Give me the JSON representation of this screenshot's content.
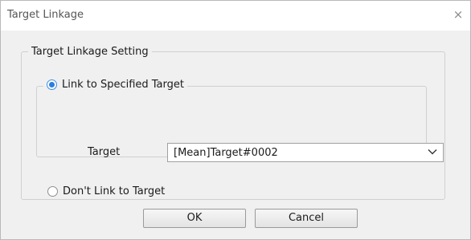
{
  "window": {
    "title": "Target Linkage",
    "close_glyph": "×"
  },
  "settings_group": {
    "legend": "Target Linkage Setting"
  },
  "link_specified": {
    "label": "Link to Specified Target",
    "checked": true
  },
  "target_field": {
    "label": "Target",
    "value": "[Mean]Target#0002"
  },
  "no_link": {
    "label": "Don't Link to Target",
    "checked": false
  },
  "buttons": {
    "ok": "OK",
    "cancel": "Cancel"
  },
  "colors": {
    "radio_accent": "#2b7de0",
    "dialog_bg": "#f0f0f0"
  },
  "icons": {
    "close": "close-icon",
    "dropdown": "chevron-down-icon"
  }
}
